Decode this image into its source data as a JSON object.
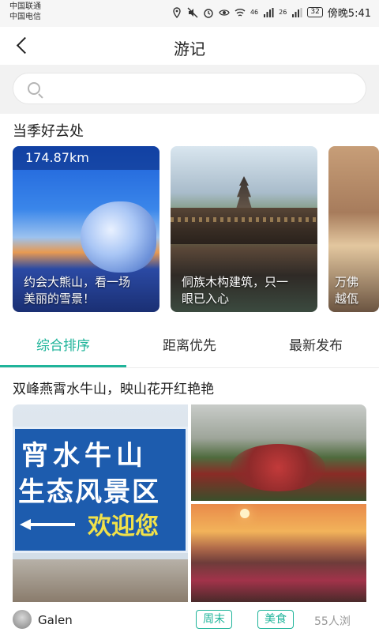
{
  "status_bar": {
    "carrier1": "中国联通",
    "carrier2": "中国电信",
    "network1": "46",
    "network2": "26",
    "battery": "32",
    "time": "傍晚5:41"
  },
  "header": {
    "title": "游记"
  },
  "search": {
    "placeholder": ""
  },
  "season": {
    "title": "当季好去处",
    "cards": [
      {
        "badge": "174.87km",
        "caption": "约会大熊山，看一场\n美丽的雪景！"
      },
      {
        "caption": "侗族木构建筑，只一\n眼已入心"
      },
      {
        "caption": "万佛\n越佤"
      }
    ]
  },
  "tabs": [
    {
      "label": "综合排序",
      "active": true
    },
    {
      "label": "距离优先",
      "active": false
    },
    {
      "label": "最新发布",
      "active": false
    }
  ],
  "post": {
    "title": "双峰燕霄水牛山，映山花开红艳艳",
    "sign_lines": [
      "宵水牛山",
      "生态风景区",
      "欢迎您"
    ],
    "author": "Galen",
    "tags": [
      "周末",
      "美食"
    ],
    "views": "55人浏"
  },
  "colors": {
    "accent": "#1fb49a",
    "text": "#222222",
    "muted": "#999999"
  }
}
